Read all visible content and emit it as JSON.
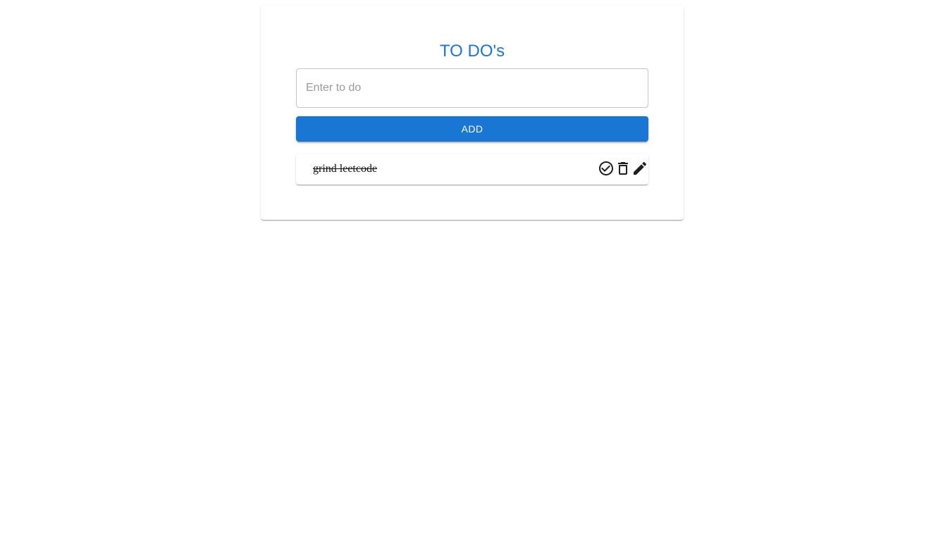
{
  "header": {
    "title": "TO DO's"
  },
  "form": {
    "input_value": "",
    "input_placeholder": "Enter to do",
    "add_label": "ADD"
  },
  "todos": [
    {
      "text": "grind leetcode",
      "completed": true,
      "icons": [
        "check-circle-icon",
        "trash-icon",
        "pencil-icon"
      ]
    }
  ],
  "colors": {
    "primary": "#1976d2",
    "icon": "#1f1f1f"
  }
}
